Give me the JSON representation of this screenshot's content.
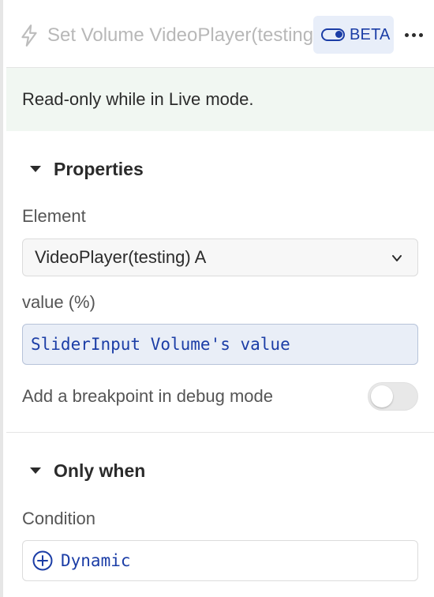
{
  "header": {
    "title": "Set Volume VideoPlayer(testing) A",
    "beta_label": "BETA",
    "icons": {
      "action": "bolt-icon",
      "beta_toggle": "toggle-icon",
      "more": "more-icon"
    }
  },
  "notice": {
    "text": "Read-only while in Live mode."
  },
  "properties": {
    "title": "Properties",
    "element_label": "Element",
    "element_value": "VideoPlayer(testing) A",
    "value_label": "value (%)",
    "value_expression": "SliderInput Volume's value",
    "breakpoint_label": "Add a breakpoint in debug mode",
    "breakpoint_enabled": false
  },
  "only_when": {
    "title": "Only when",
    "condition_label": "Condition",
    "dynamic_label": "Dynamic"
  },
  "colors": {
    "accent": "#1b3da6",
    "notice_bg": "#f1f7f2",
    "beta_bg": "#e8eef9",
    "expression_bg": "#e9eef7"
  }
}
